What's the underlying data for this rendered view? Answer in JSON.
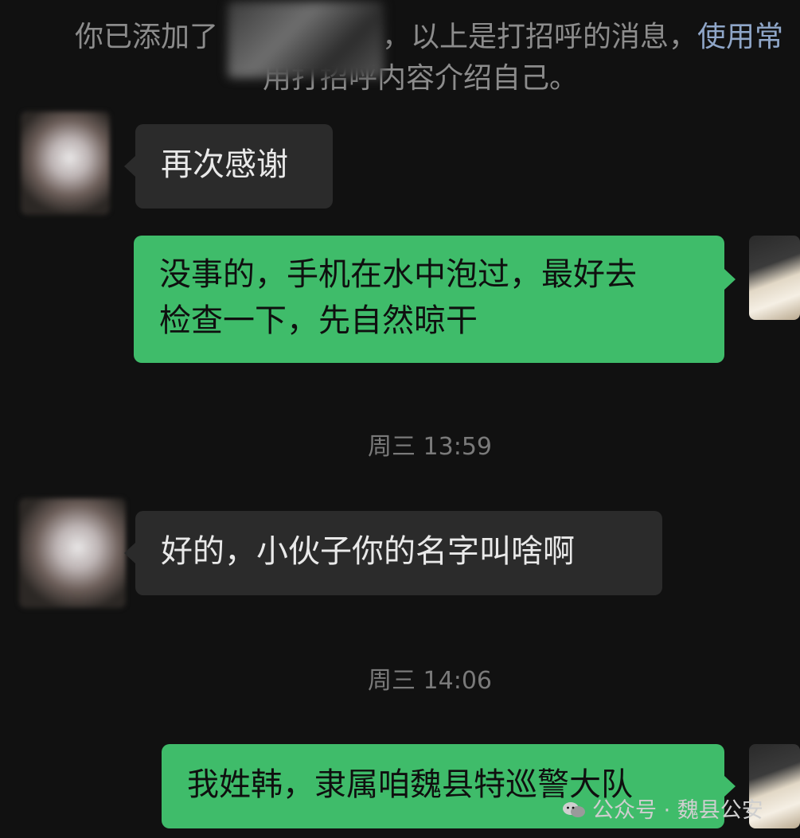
{
  "system_notice": {
    "line1_prefix": "你已添加了",
    "line1_mid": "，以上是打招呼的消息，",
    "line1_link": "使用常",
    "line2": "用打招呼内容介绍自己。"
  },
  "messages": [
    {
      "id": "m1",
      "from": "contact",
      "text": "再次感谢"
    },
    {
      "id": "m2",
      "from": "me",
      "lines": [
        "没事的，手机在水中泡过，最好去",
        "检查一下，先自然晾干"
      ]
    },
    {
      "id": "m3",
      "from": "contact",
      "text": "好的，小伙子你的名字叫啥啊"
    },
    {
      "id": "m4",
      "from": "me",
      "text": "我姓韩，隶属咱魏县特巡警大队"
    }
  ],
  "timestamps": [
    "周三 13:59",
    "周三 14:06"
  ],
  "watermark": {
    "text": "公众号 · 魏县公安",
    "icon": "wechat-icon"
  },
  "colors": {
    "background": "#111111",
    "incoming_bubble": "#2b2b2b",
    "outgoing_bubble": "#3fbc6a",
    "link": "#8fa6c8"
  }
}
